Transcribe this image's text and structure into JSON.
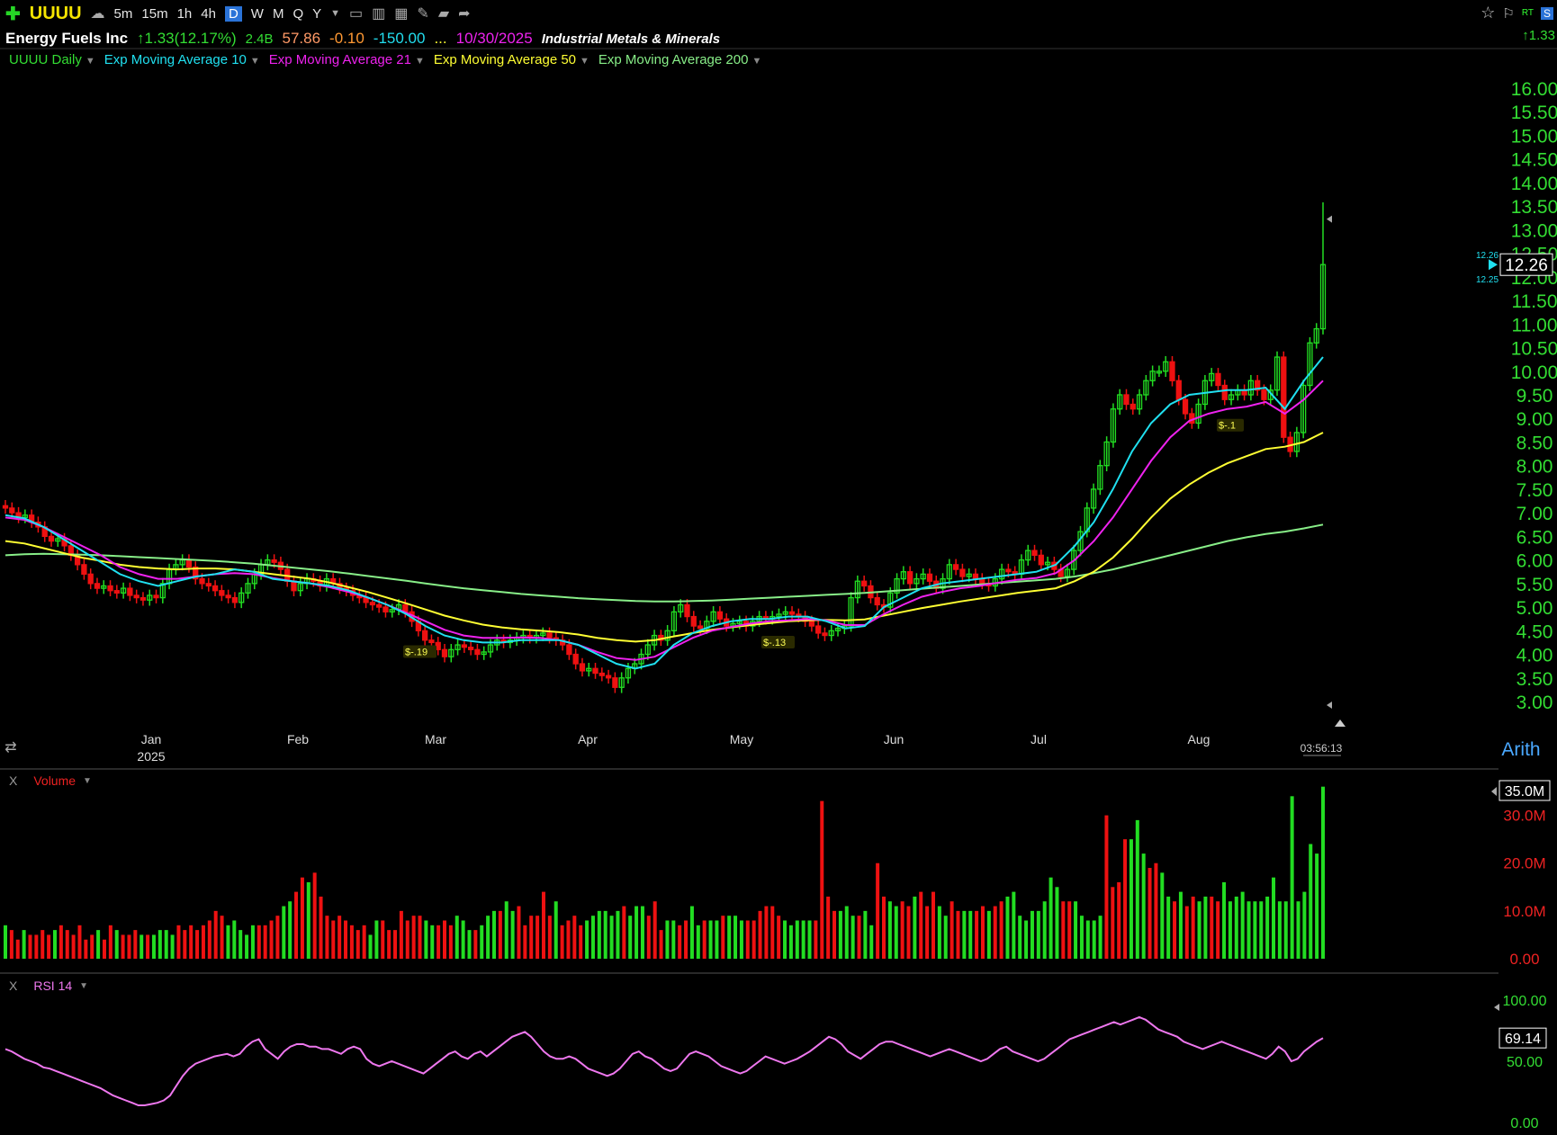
{
  "toolbar": {
    "symbol": "UUUU",
    "timeframes": [
      "5m",
      "15m",
      "1h",
      "4h",
      "D",
      "W",
      "M",
      "Q",
      "Y"
    ],
    "active_timeframe": "D"
  },
  "header": {
    "company": "Energy Fuels Inc",
    "change": "1.33(12.17%)",
    "volume": "2.4B",
    "val1": "57.86",
    "val2": "-0.10",
    "val3": "-150.00",
    "ellipsis": "...",
    "date": "10/30/2025",
    "industry": "Industrial Metals & Minerals",
    "right_change": "1.33"
  },
  "legend": {
    "daily": "UUUU Daily",
    "ema10": "Exp Moving Average 10",
    "ema21": "Exp Moving Average 21",
    "ema50": "Exp Moving Average 50",
    "ema200": "Exp Moving Average 200"
  },
  "colors": {
    "up": "#22dd22",
    "down": "#ee1111",
    "ema10": "#20e0f0",
    "ema21": "#ee22ee",
    "ema50": "#ffff33",
    "ema200": "#88ee88",
    "rsi": "#ee77ee",
    "axis_green": "#33dd33"
  },
  "price_axis": {
    "labels": [
      "16.00",
      "15.50",
      "15.00",
      "14.50",
      "14.00",
      "13.50",
      "13.00",
      "12.50",
      "12.00",
      "11.50",
      "11.00",
      "10.50",
      "10.00",
      "9.50",
      "9.00",
      "8.50",
      "8.00",
      "7.50",
      "7.00",
      "6.50",
      "6.00",
      "5.50",
      "5.00",
      "4.50",
      "4.00",
      "3.50",
      "3.00"
    ],
    "last_price": "12.26",
    "small_top": "12.26",
    "small_bottom": "12.25",
    "scale": "Arith",
    "timer": "03:56:13"
  },
  "time_axis": {
    "months": [
      "Jan",
      "Feb",
      "Mar",
      "Apr",
      "May",
      "Jun",
      "Jul",
      "Aug"
    ],
    "year": "2025"
  },
  "dividend_labels": [
    "$-.19",
    "$-.13",
    "$-.1"
  ],
  "volume_panel": {
    "label": "Volume",
    "close_x": "X",
    "axis_labels": [
      "30.0M",
      "20.0M",
      "10.0M",
      "0.00"
    ],
    "last": "35.0M"
  },
  "rsi_panel": {
    "label": "RSI 14",
    "close_x": "X",
    "axis_labels": [
      "100.00",
      "50.00",
      "0.00"
    ],
    "last": "69.14"
  },
  "chart_data": {
    "type": "candlestick",
    "ylim": [
      3.0,
      16.0
    ],
    "start_price": 7.1,
    "closes": [
      7.1,
      7.0,
      6.9,
      6.95,
      6.8,
      6.7,
      6.5,
      6.4,
      6.45,
      6.3,
      6.1,
      5.9,
      5.7,
      5.5,
      5.4,
      5.45,
      5.35,
      5.3,
      5.4,
      5.25,
      5.2,
      5.15,
      5.25,
      5.2,
      5.5,
      5.8,
      5.9,
      6.0,
      5.85,
      5.6,
      5.5,
      5.45,
      5.35,
      5.25,
      5.2,
      5.1,
      5.3,
      5.5,
      5.7,
      5.9,
      6.0,
      5.95,
      5.8,
      5.55,
      5.35,
      5.5,
      5.6,
      5.55,
      5.45,
      5.6,
      5.5,
      5.4,
      5.35,
      5.25,
      5.2,
      5.1,
      5.05,
      5.0,
      4.9,
      4.95,
      5.05,
      4.9,
      4.7,
      4.5,
      4.3,
      4.25,
      4.1,
      3.95,
      4.1,
      4.2,
      4.15,
      4.1,
      4.0,
      4.05,
      4.2,
      4.3,
      4.25,
      4.3,
      4.35,
      4.4,
      4.35,
      4.4,
      4.45,
      4.35,
      4.3,
      4.2,
      4.0,
      3.8,
      3.65,
      3.7,
      3.6,
      3.55,
      3.5,
      3.3,
      3.5,
      3.7,
      3.8,
      4.0,
      4.2,
      4.4,
      4.3,
      4.5,
      4.9,
      5.05,
      4.8,
      4.6,
      4.55,
      4.7,
      4.9,
      4.75,
      4.6,
      4.65,
      4.7,
      4.6,
      4.7,
      4.8,
      4.75,
      4.8,
      4.85,
      4.9,
      4.85,
      4.8,
      4.7,
      4.6,
      4.45,
      4.4,
      4.5,
      4.55,
      4.6,
      5.2,
      5.55,
      5.45,
      5.2,
      5.05,
      5.0,
      5.3,
      5.6,
      5.75,
      5.5,
      5.6,
      5.7,
      5.55,
      5.4,
      5.6,
      5.9,
      5.8,
      5.65,
      5.7,
      5.6,
      5.5,
      5.45,
      5.6,
      5.8,
      5.75,
      5.7,
      6.0,
      6.2,
      6.1,
      5.9,
      5.95,
      5.8,
      5.65,
      5.8,
      6.2,
      6.6,
      7.1,
      7.5,
      8.0,
      8.5,
      9.2,
      9.5,
      9.3,
      9.2,
      9.5,
      9.8,
      10.0,
      10.0,
      10.2,
      9.8,
      9.4,
      9.1,
      8.9,
      9.3,
      9.8,
      9.95,
      9.7,
      9.4,
      9.5,
      9.6,
      9.5,
      9.8,
      9.6,
      9.4,
      9.6,
      10.3,
      8.6,
      8.3,
      8.7,
      9.7,
      10.6,
      10.9,
      12.26
    ],
    "ema10": [
      6.95,
      6.88,
      6.7,
      6.45,
      6.2,
      5.95,
      5.7,
      5.55,
      5.45,
      5.55,
      5.65,
      5.7,
      5.8,
      5.75,
      5.6,
      5.55,
      5.5,
      5.45,
      5.35,
      5.2,
      5.05,
      4.85,
      4.6,
      4.4,
      4.3,
      4.25,
      4.25,
      4.3,
      4.3,
      4.3,
      4.2,
      4.0,
      3.8,
      3.7,
      3.8,
      4.2,
      4.45,
      4.6,
      4.7,
      4.75,
      4.75,
      4.8,
      4.8,
      4.7,
      4.55,
      4.6,
      5.0,
      5.2,
      5.4,
      5.5,
      5.55,
      5.6,
      5.65,
      5.7,
      5.75,
      5.9,
      6.3,
      6.8,
      7.5,
      8.3,
      8.9,
      9.3,
      9.5,
      9.55,
      9.6,
      9.6,
      9.65,
      9.2,
      9.8,
      10.3
    ],
    "ema21": [
      6.9,
      6.85,
      6.7,
      6.5,
      6.3,
      6.1,
      5.85,
      5.7,
      5.6,
      5.6,
      5.65,
      5.7,
      5.72,
      5.7,
      5.62,
      5.55,
      5.5,
      5.42,
      5.32,
      5.2,
      5.05,
      4.88,
      4.7,
      4.52,
      4.4,
      4.35,
      4.35,
      4.36,
      4.35,
      4.3,
      4.2,
      4.05,
      3.92,
      3.88,
      3.95,
      4.15,
      4.35,
      4.5,
      4.58,
      4.65,
      4.7,
      4.72,
      4.75,
      4.72,
      4.62,
      4.62,
      4.85,
      5.05,
      5.22,
      5.32,
      5.4,
      5.45,
      5.52,
      5.58,
      5.62,
      5.72,
      6.0,
      6.4,
      6.9,
      7.5,
      8.1,
      8.6,
      8.95,
      9.1,
      9.2,
      9.25,
      9.35,
      9.1,
      9.4,
      9.8
    ],
    "ema50": [
      6.4,
      6.35,
      6.25,
      6.15,
      6.05,
      5.98,
      5.9,
      5.85,
      5.82,
      5.8,
      5.82,
      5.82,
      5.8,
      5.75,
      5.7,
      5.65,
      5.6,
      5.52,
      5.42,
      5.32,
      5.2,
      5.08,
      4.95,
      4.82,
      4.72,
      4.63,
      4.57,
      4.53,
      4.5,
      4.47,
      4.42,
      4.35,
      4.3,
      4.27,
      4.3,
      4.38,
      4.45,
      4.52,
      4.57,
      4.62,
      4.66,
      4.7,
      4.72,
      4.73,
      4.72,
      4.74,
      4.82,
      4.9,
      4.98,
      5.05,
      5.12,
      5.18,
      5.24,
      5.3,
      5.35,
      5.4,
      5.55,
      5.75,
      6.05,
      6.45,
      6.9,
      7.3,
      7.6,
      7.85,
      8.05,
      8.2,
      8.35,
      8.4,
      8.5,
      8.7
    ],
    "ema200": [
      6.1,
      6.12,
      6.13,
      6.12,
      6.11,
      6.1,
      6.08,
      6.06,
      6.04,
      6.02,
      6.0,
      5.98,
      5.95,
      5.92,
      5.88,
      5.84,
      5.8,
      5.76,
      5.71,
      5.66,
      5.61,
      5.56,
      5.5,
      5.45,
      5.4,
      5.36,
      5.32,
      5.28,
      5.25,
      5.22,
      5.19,
      5.17,
      5.15,
      5.13,
      5.12,
      5.12,
      5.13,
      5.14,
      5.16,
      5.18,
      5.2,
      5.22,
      5.24,
      5.26,
      5.28,
      5.3,
      5.33,
      5.36,
      5.39,
      5.42,
      5.45,
      5.48,
      5.51,
      5.54,
      5.57,
      5.6,
      5.65,
      5.72,
      5.8,
      5.9,
      6.0,
      6.1,
      6.2,
      6.3,
      6.4,
      6.48,
      6.55,
      6.6,
      6.67,
      6.75
    ],
    "volume_ylim": [
      0,
      35
    ],
    "volume": [
      7,
      6,
      4,
      6,
      5,
      5,
      6,
      5,
      6,
      7,
      6,
      5,
      7,
      4,
      5,
      6,
      4,
      7,
      6,
      5,
      5,
      6,
      5,
      5,
      5,
      6,
      6,
      5,
      7,
      6,
      7,
      6,
      7,
      8,
      10,
      9,
      7,
      8,
      6,
      5,
      7,
      7,
      7,
      8,
      9,
      11,
      12,
      14,
      17,
      16,
      18,
      13,
      9,
      8,
      9,
      8,
      7,
      6,
      7,
      5,
      8,
      8,
      6,
      6,
      10,
      8,
      9,
      9,
      8,
      7,
      7,
      8,
      7,
      9,
      8,
      6,
      6,
      7,
      9,
      10,
      10,
      12,
      10,
      11,
      7,
      9,
      9,
      14,
      9,
      12,
      7,
      8,
      9,
      7,
      8,
      9,
      10,
      10,
      9,
      10,
      11,
      9,
      11,
      11,
      9,
      12,
      6,
      8,
      8,
      7,
      8,
      11,
      7,
      8,
      8,
      8,
      9,
      9,
      9,
      8,
      8,
      8,
      10,
      11,
      11,
      9,
      8,
      7,
      8,
      8,
      8,
      8,
      33,
      13,
      10,
      10,
      11,
      9,
      9,
      10,
      7,
      20,
      13,
      12,
      11,
      12,
      11,
      13,
      14,
      11,
      14,
      11,
      9,
      12,
      10,
      10,
      10,
      10,
      11,
      10,
      11,
      12,
      13,
      14,
      9,
      8,
      10,
      10,
      12,
      17,
      15,
      12,
      12,
      12,
      9,
      8,
      8,
      9,
      30,
      15,
      16,
      25,
      25,
      29,
      22,
      19,
      20,
      18,
      13,
      12,
      14,
      11,
      13,
      12,
      13,
      13,
      12,
      16,
      12,
      13,
      14,
      12,
      12,
      12,
      13,
      17,
      12,
      12,
      34,
      12,
      14,
      24,
      22,
      36
    ],
    "rsi_ylim": [
      0,
      100
    ],
    "rsi": [
      60,
      58,
      55,
      52,
      50,
      48,
      45,
      44,
      42,
      40,
      38,
      36,
      34,
      32,
      30,
      28,
      25,
      22,
      20,
      18,
      16,
      14,
      14,
      15,
      16,
      18,
      22,
      30,
      38,
      44,
      48,
      50,
      52,
      54,
      55,
      56,
      54,
      56,
      62,
      66,
      68,
      60,
      56,
      52,
      58,
      62,
      64,
      64,
      62,
      62,
      60,
      60,
      58,
      56,
      60,
      62,
      60,
      52,
      48,
      46,
      48,
      50,
      48,
      46,
      44,
      42,
      40,
      44,
      48,
      52,
      56,
      58,
      54,
      52,
      56,
      58,
      54,
      58,
      62,
      66,
      70,
      72,
      74,
      70,
      64,
      58,
      54,
      52,
      52,
      54,
      52,
      48,
      44,
      42,
      40,
      38,
      40,
      44,
      50,
      56,
      58,
      54,
      52,
      48,
      44,
      42,
      44,
      50,
      56,
      58,
      56,
      54,
      50,
      46,
      44,
      42,
      40,
      42,
      46,
      50,
      54,
      52,
      50,
      48,
      50,
      52,
      55,
      58,
      62,
      66,
      70,
      68,
      64,
      58,
      55,
      52,
      56,
      60,
      64,
      66,
      66,
      64,
      62,
      60,
      58,
      56,
      54,
      56,
      58,
      60,
      58,
      56,
      54,
      52,
      50,
      52,
      56,
      60,
      62,
      58,
      56,
      54,
      52,
      50,
      52,
      56,
      60,
      64,
      68,
      70,
      72,
      74,
      76,
      78,
      80,
      82,
      80,
      82,
      84,
      86,
      84,
      80,
      76,
      74,
      72,
      70,
      66,
      64,
      62,
      60,
      62,
      64,
      66,
      64,
      62,
      60,
      58,
      56,
      54,
      52,
      56,
      62,
      58,
      50,
      52,
      58,
      62,
      66,
      69
    ],
    "x_labels_positions_days": [
      0
    ]
  }
}
